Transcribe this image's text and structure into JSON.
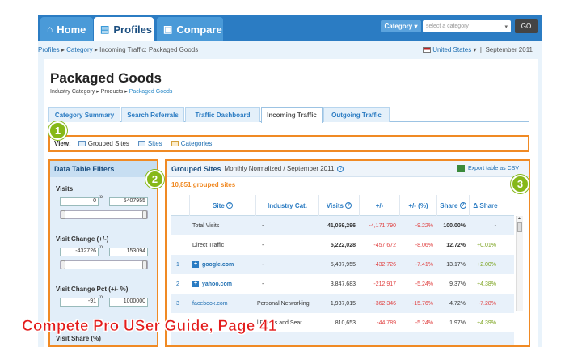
{
  "nav": {
    "tabs": [
      {
        "label": "Home",
        "icon": "home-icon"
      },
      {
        "label": "Profiles",
        "icon": "profile-icon"
      },
      {
        "label": "Compare",
        "icon": "compare-icon"
      }
    ],
    "category_button": "Category",
    "category_placeholder": "select a category",
    "go": "GO"
  },
  "breadcrumb": {
    "profiles": "Profiles",
    "category": "Category",
    "current": "Incoming Traffic: Packaged Goods"
  },
  "region": {
    "country": "United States",
    "date": "September 2011"
  },
  "page": {
    "title": "Packaged Goods",
    "sub_label": "Industry Category",
    "sub_products": "Products",
    "sub_current": "Packaged Goods"
  },
  "subtabs": [
    "Category Summary",
    "Search Referrals",
    "Traffic Dashboard",
    "Incoming Traffic",
    "Outgoing Traffic"
  ],
  "view": {
    "label": "View:",
    "items": [
      "Grouped Sites",
      "Sites",
      "Categories"
    ]
  },
  "badges": [
    "1",
    "2",
    "3"
  ],
  "filters": {
    "title": "Data Table Filters",
    "items": [
      {
        "title": "Visits",
        "min": "0",
        "max": "5407955"
      },
      {
        "title": "Visit Change (+/-)",
        "min": "-432726",
        "max": "153094"
      },
      {
        "title": "Visit Change Pct (+/- %)",
        "min": "-91",
        "max": "1000000"
      },
      {
        "title": "Visit Share (%)"
      }
    ],
    "to": "to"
  },
  "table": {
    "title": "Grouped Sites",
    "subtitle": "Monthly Normalized / September 2011",
    "export": "Export table as CSV",
    "count": "10,851 grouped sites",
    "headers": [
      "Site",
      "Industry Cat.",
      "Visits",
      "+/-",
      "+/- (%)",
      "Share",
      "Δ Share"
    ],
    "rows": [
      {
        "idx": "",
        "site": "Total Visits",
        "cat": "-",
        "visits": "41,059,296",
        "delta": "-4,171,790",
        "pct": "-9.22%",
        "share": "100.00%",
        "dshare": "-"
      },
      {
        "idx": "",
        "site": "Direct Traffic",
        "cat": "-",
        "visits": "5,222,028",
        "delta": "-457,672",
        "pct": "-8.06%",
        "share": "12.72%",
        "dshare": "+0.01%"
      },
      {
        "idx": "1",
        "site": "google.com",
        "cat": "-",
        "visits": "5,407,955",
        "delta": "-432,726",
        "pct": "-7.41%",
        "share": "13.17%",
        "dshare": "+2.00%"
      },
      {
        "idx": "2",
        "site": "yahoo.com",
        "cat": "-",
        "visits": "3,847,683",
        "delta": "-212,917",
        "pct": "-5.24%",
        "share": "9.37%",
        "dshare": "+4.38%"
      },
      {
        "idx": "3",
        "site": "facebook.com",
        "cat": "Personal Networking",
        "visits": "1,937,015",
        "delta": "-362,346",
        "pct": "-15.76%",
        "share": "4.72%",
        "dshare": "-7.28%"
      },
      {
        "idx": "",
        "site": "",
        "cat": "l Portals and Sear",
        "visits": "810,653",
        "delta": "-44,789",
        "pct": "-5.24%",
        "share": "1.97%",
        "dshare": "+4.39%"
      }
    ]
  },
  "caption": "Compete Pro USer Guide, Page 41",
  "colors": {
    "accent": "#f08a24",
    "nav": "#2b7cc3",
    "badge": "#86b818",
    "caption": "#e31b1b"
  }
}
